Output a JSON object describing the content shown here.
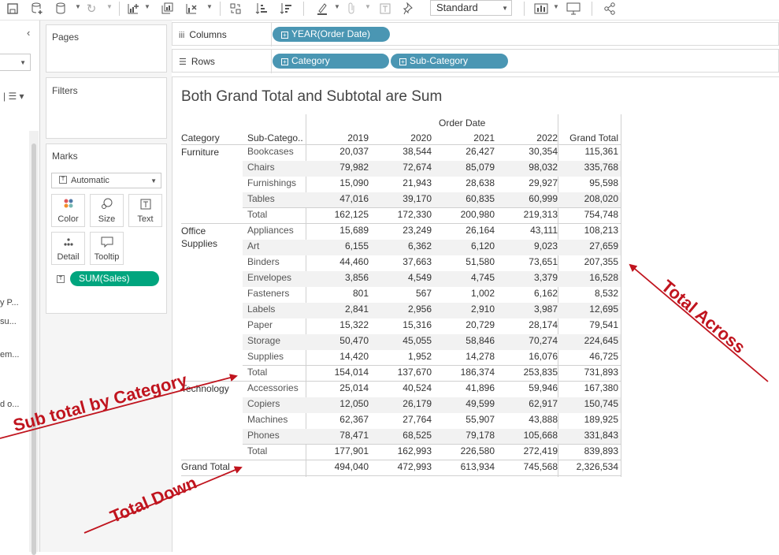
{
  "toolbar": {
    "view_mode": "Standard",
    "icons": [
      "save-icon",
      "new-datasource-icon",
      "datasource-icon",
      "refresh-icon",
      "new-worksheet-icon",
      "duplicate-icon",
      "clear-sheet-icon",
      "swap-icon",
      "sort-ascending-icon",
      "sort-descending-icon",
      "highlight-icon",
      "attach-icon",
      "text-label-icon",
      "pin-icon",
      "show-me-icon",
      "presentation-icon",
      "share-icon"
    ]
  },
  "left_pane": {
    "truncated_items": [
      "y P...",
      "su...",
      "em...",
      "d o..."
    ]
  },
  "cards": {
    "pages_title": "Pages",
    "filters_title": "Filters",
    "marks_title": "Marks",
    "marks_type": "Automatic",
    "mark_buttons": [
      "Color",
      "Size",
      "Text",
      "Detail",
      "Tooltip"
    ],
    "marks_pill": "SUM(Sales)"
  },
  "shelves": {
    "columns_label": "Columns",
    "rows_label": "Rows",
    "column_pills": [
      "YEAR(Order Date)"
    ],
    "row_pills": [
      "Category",
      "Sub-Category"
    ]
  },
  "viz": {
    "title": "Both Grand Total and Subtotal are Sum",
    "header_group": "Order Date",
    "columns": [
      "Category",
      "Sub-Catego..",
      "2019",
      "2020",
      "2021",
      "2022",
      "Grand Total"
    ],
    "groups": [
      {
        "category": "Furniture",
        "rows": [
          {
            "sub": "Bookcases",
            "values": [
              "20,037",
              "38,544",
              "26,427",
              "30,354",
              "115,361"
            ]
          },
          {
            "sub": "Chairs",
            "values": [
              "79,982",
              "72,674",
              "85,079",
              "98,032",
              "335,768"
            ]
          },
          {
            "sub": "Furnishings",
            "values": [
              "15,090",
              "21,943",
              "28,638",
              "29,927",
              "95,598"
            ]
          },
          {
            "sub": "Tables",
            "values": [
              "47,016",
              "39,170",
              "60,835",
              "60,999",
              "208,020"
            ]
          }
        ],
        "total": {
          "label": "Total",
          "values": [
            "162,125",
            "172,330",
            "200,980",
            "219,313",
            "754,748"
          ]
        }
      },
      {
        "category": "Office Supplies",
        "rows": [
          {
            "sub": "Appliances",
            "values": [
              "15,689",
              "23,249",
              "26,164",
              "43,111",
              "108,213"
            ]
          },
          {
            "sub": "Art",
            "values": [
              "6,155",
              "6,362",
              "6,120",
              "9,023",
              "27,659"
            ]
          },
          {
            "sub": "Binders",
            "values": [
              "44,460",
              "37,663",
              "51,580",
              "73,651",
              "207,355"
            ]
          },
          {
            "sub": "Envelopes",
            "values": [
              "3,856",
              "4,549",
              "4,745",
              "3,379",
              "16,528"
            ]
          },
          {
            "sub": "Fasteners",
            "values": [
              "801",
              "567",
              "1,002",
              "6,162",
              "8,532"
            ]
          },
          {
            "sub": "Labels",
            "values": [
              "2,841",
              "2,956",
              "2,910",
              "3,987",
              "12,695"
            ]
          },
          {
            "sub": "Paper",
            "values": [
              "15,322",
              "15,316",
              "20,729",
              "28,174",
              "79,541"
            ]
          },
          {
            "sub": "Storage",
            "values": [
              "50,470",
              "45,055",
              "58,846",
              "70,274",
              "224,645"
            ]
          },
          {
            "sub": "Supplies",
            "values": [
              "14,420",
              "1,952",
              "14,278",
              "16,076",
              "46,725"
            ]
          }
        ],
        "total": {
          "label": "Total",
          "values": [
            "154,014",
            "137,670",
            "186,374",
            "253,835",
            "731,893"
          ]
        }
      },
      {
        "category": "Technology",
        "rows": [
          {
            "sub": "Accessories",
            "values": [
              "25,014",
              "40,524",
              "41,896",
              "59,946",
              "167,380"
            ]
          },
          {
            "sub": "Copiers",
            "values": [
              "12,050",
              "26,179",
              "49,599",
              "62,917",
              "150,745"
            ]
          },
          {
            "sub": "Machines",
            "values": [
              "62,367",
              "27,764",
              "55,907",
              "43,888",
              "189,925"
            ]
          },
          {
            "sub": "Phones",
            "values": [
              "78,471",
              "68,525",
              "79,178",
              "105,668",
              "331,843"
            ]
          }
        ],
        "total": {
          "label": "Total",
          "values": [
            "177,901",
            "162,993",
            "226,580",
            "272,419",
            "839,893"
          ]
        }
      }
    ],
    "grand_total": {
      "label": "Grand Total",
      "values": [
        "494,040",
        "472,993",
        "613,934",
        "745,568",
        "2,326,534"
      ]
    }
  },
  "annotations": {
    "subtotal": "Sub total by Category",
    "total_down": "Total Down",
    "total_across": "Total Across",
    "color": "#c0141e"
  }
}
